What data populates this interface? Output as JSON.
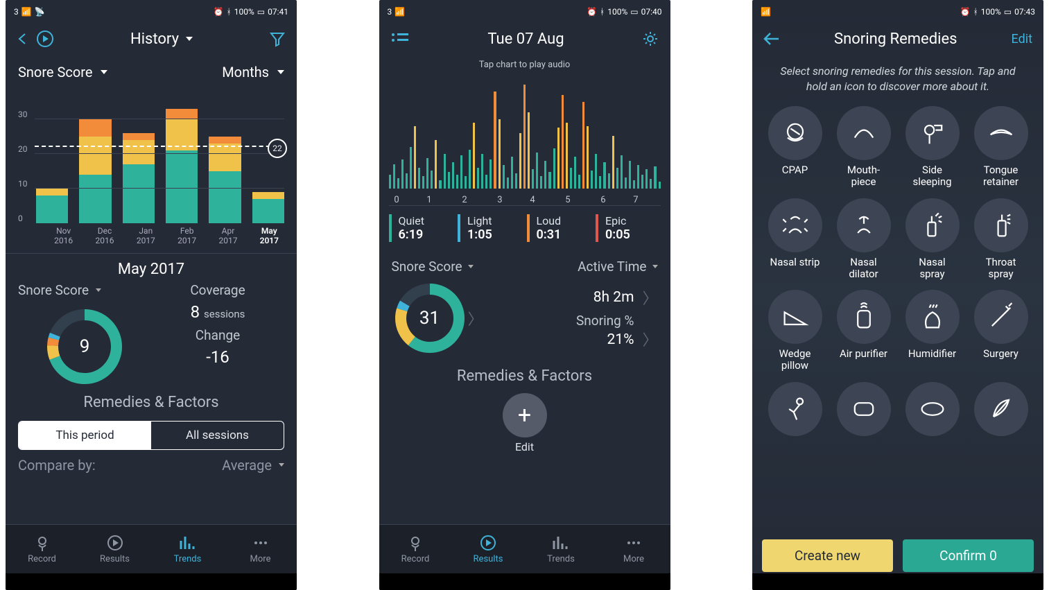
{
  "chart_data": [
    {
      "type": "bar",
      "title": "Snore Score",
      "categories": [
        "Nov 2016",
        "Dec 2016",
        "Jan 2017",
        "Feb 2017",
        "Apr 2017",
        "May 2017"
      ],
      "series": [
        {
          "name": "teal",
          "values": [
            8,
            14,
            17,
            21,
            15,
            7
          ]
        },
        {
          "name": "yellow",
          "values": [
            2,
            11,
            7,
            9,
            8,
            2
          ]
        },
        {
          "name": "orange",
          "values": [
            0,
            5,
            2,
            3,
            2,
            0
          ]
        }
      ],
      "stacked_totals": [
        10,
        30,
        26,
        33,
        25,
        9
      ],
      "ylim": [
        0,
        35
      ],
      "yticks": [
        0,
        10,
        20,
        30
      ],
      "reference_line": 22
    },
    {
      "type": "donut",
      "title": "Snore Score",
      "value": 9,
      "segments": [
        {
          "name": "teal",
          "value": 70
        },
        {
          "name": "yellow",
          "value": 6
        },
        {
          "name": "orange",
          "value": 4
        },
        {
          "name": "blue",
          "value": 2
        },
        {
          "name": "empty",
          "value": 18
        }
      ]
    },
    {
      "type": "area",
      "title": "Tap chart to play audio",
      "x_ticks": [
        0,
        1,
        2,
        3,
        4,
        5,
        6,
        7
      ],
      "note": "waveform with overlapping teal/yellow/orange spikes — heights estimated",
      "series": [
        {
          "name": "Quiet",
          "color": "#2fb29b"
        },
        {
          "name": "Light",
          "color": "#f0c24a"
        },
        {
          "name": "Loud",
          "color": "#f28c3b"
        },
        {
          "name": "Epic",
          "color": "#e0574f"
        }
      ]
    },
    {
      "type": "donut",
      "title": "Snore Score",
      "value": 31,
      "segments": [
        {
          "name": "teal",
          "value": 60
        },
        {
          "name": "yellow",
          "value": 18
        },
        {
          "name": "blue",
          "value": 4
        },
        {
          "name": "dark",
          "value": 18
        }
      ]
    }
  ],
  "screen1": {
    "status": {
      "left": "3",
      "battery": "100%",
      "time": "07:41"
    },
    "title": "History",
    "metric_selector": "Snore Score",
    "range_selector": "Months",
    "avg_badge": "22",
    "current_period": "May 2017",
    "left_selector": "Snore Score",
    "right_title": "Coverage",
    "sessions_count": "8",
    "sessions_unit": "sessions",
    "change_label": "Change",
    "change_value": "-16",
    "donut_value": "9",
    "remedies_title": "Remedies & Factors",
    "toggle": {
      "a": "This period",
      "b": "All sessions"
    },
    "compare_label": "Compare by:",
    "compare_value": "Average",
    "nav": {
      "record": "Record",
      "results": "Results",
      "trends": "Trends",
      "more": "More"
    }
  },
  "screen2": {
    "status": {
      "left": "3",
      "battery": "100%",
      "time": "07:40"
    },
    "title": "Tue 07 Aug",
    "chart_hint": "Tap chart to play audio",
    "legend": [
      {
        "label": "Quiet",
        "value": "6:19",
        "color": "#2fb29b"
      },
      {
        "label": "Light",
        "value": "1:05",
        "color": "#3fb3d9"
      },
      {
        "label": "Loud",
        "value": "0:31",
        "color": "#f28c3b"
      },
      {
        "label": "Epic",
        "value": "0:05",
        "color": "#e0574f"
      }
    ],
    "score_label": "Snore Score",
    "score_value": "31",
    "active_label": "Active Time",
    "active_value": "8h 2m",
    "snoring_label": "Snoring %",
    "snoring_value": "21%",
    "remedies_title": "Remedies & Factors",
    "edit_label": "Edit",
    "nav": {
      "record": "Record",
      "results": "Results",
      "trends": "Trends",
      "more": "More"
    }
  },
  "screen3": {
    "status": {
      "battery": "100%",
      "time": "07:43"
    },
    "title": "Snoring Remedies",
    "edit": "Edit",
    "help": "Select snoring remedies for this session. Tap and hold an icon to discover more about it.",
    "remedies": [
      "CPAP",
      "Mouth-\npiece",
      "Side\nsleeping",
      "Tongue\nretainer",
      "Nasal strip",
      "Nasal\ndilator",
      "Nasal\nspray",
      "Throat\nspray",
      "Wedge\npillow",
      "Air purifier",
      "Humidifier",
      "Surgery",
      "",
      "",
      "",
      ""
    ],
    "create_btn": "Create new",
    "confirm_btn": "Confirm 0"
  }
}
